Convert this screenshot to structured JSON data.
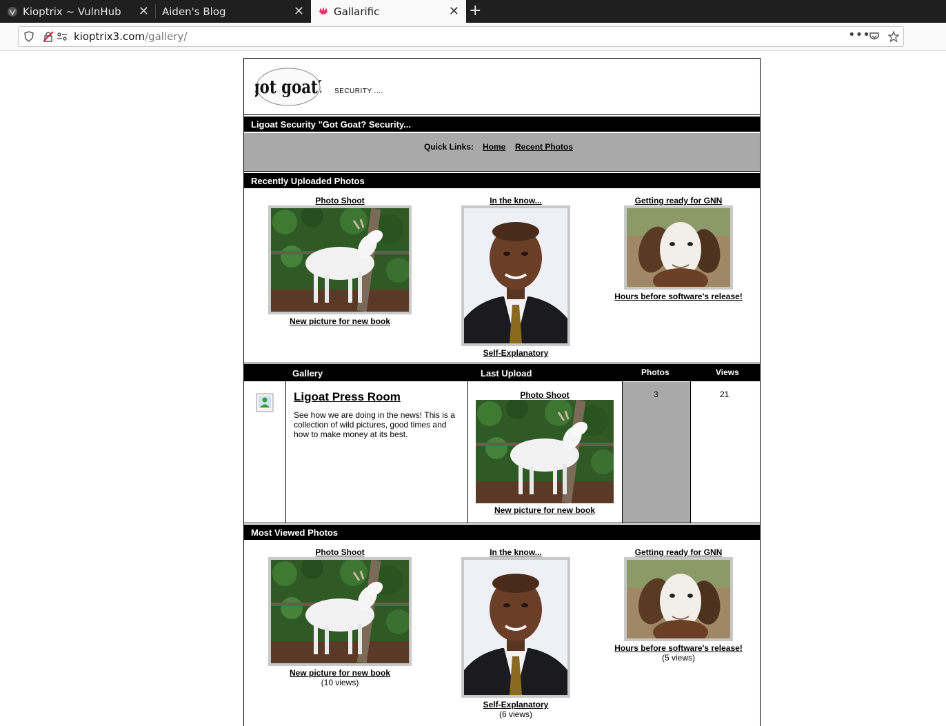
{
  "browser": {
    "tabs": [
      {
        "label": "Kioptrix ~ VulnHub",
        "favicon": "vulnhub-icon"
      },
      {
        "label": "Aiden's Blog",
        "favicon": "none"
      },
      {
        "label": "Gallarific",
        "favicon": "gallarific-icon"
      }
    ],
    "url_host": "kioptrix3.com",
    "url_path": "/gallery/"
  },
  "site": {
    "logo_text": "got goat?",
    "slogan": "SECURITY ....",
    "title_bar": "Ligoat Security \"Got Goat? Security...",
    "quick_links_label": "Quick Links:",
    "quick_links": [
      "Home",
      "Recent Photos"
    ]
  },
  "recent": {
    "heading": "Recently Uploaded Photos",
    "photos": [
      {
        "title": "Photo Shoot",
        "caption": "New picture for new book",
        "image": "white-goat-photo"
      },
      {
        "title": "In the know...",
        "caption": "Self-Explanatory",
        "image": "man-portrait-photo"
      },
      {
        "title": "Getting ready for GNN",
        "caption": "Hours before software's release!",
        "image": "goat-face-photo"
      }
    ]
  },
  "gallery_table": {
    "headers": {
      "gallery": "Gallery",
      "last_upload": "Last Upload",
      "photos": "Photos",
      "views": "Views"
    },
    "row": {
      "title": "Ligoat Press Room",
      "description": "See how we are doing in the news! This is a collection of wild pictures, good times and how to make money at its best.",
      "last_upload_title": "Photo Shoot",
      "last_upload_caption": "New picture for new book",
      "photos": "3",
      "views": "21"
    }
  },
  "most_viewed": {
    "heading": "Most Viewed Photos",
    "photos": [
      {
        "title": "Photo Shoot",
        "caption": "New picture for new book",
        "views": "(10 views)"
      },
      {
        "title": "In the know...",
        "caption": "Self-Explanatory",
        "views": "(6 views)"
      },
      {
        "title": "Getting ready for GNN",
        "caption": "Hours before software's release!",
        "views": "(5 views)"
      }
    ]
  }
}
